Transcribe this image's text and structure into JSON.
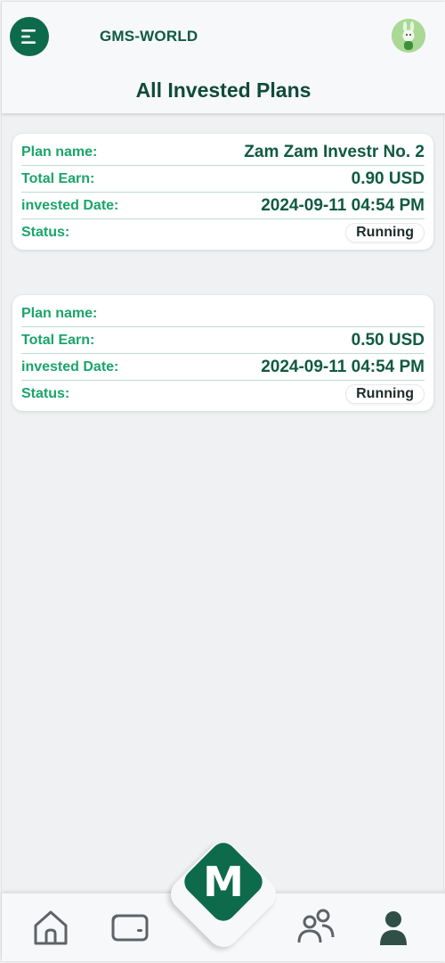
{
  "header": {
    "brand": "GMS-WORLD",
    "page_title": "All Invested Plans",
    "menu_icon": "menu-icon",
    "avatar_icon": "rabbit-avatar"
  },
  "plans": [
    {
      "plan_name_label": "Plan name:",
      "plan_name": "Zam Zam Investr No. 2",
      "total_earn_label": "Total Earn:",
      "total_earn": "0.90 USD",
      "invested_date_label": "invested Date:",
      "invested_date": "2024-09-11 04:54 PM",
      "status_label": "Status:",
      "status": "Running"
    },
    {
      "plan_name_label": "Plan name:",
      "plan_name": "",
      "total_earn_label": "Total Earn:",
      "total_earn": "0.50 USD",
      "invested_date_label": "invested Date:",
      "invested_date": "2024-09-11 04:54 PM",
      "status_label": "Status:",
      "status": "Running"
    }
  ],
  "bottom_nav": {
    "items": [
      "home-icon",
      "wallet-icon",
      "users-icon",
      "profile-icon"
    ],
    "center_letter": "M"
  },
  "colors": {
    "accent": "#0d6b4c",
    "label_green": "#1aa56a",
    "value_green": "#0f5a42"
  }
}
